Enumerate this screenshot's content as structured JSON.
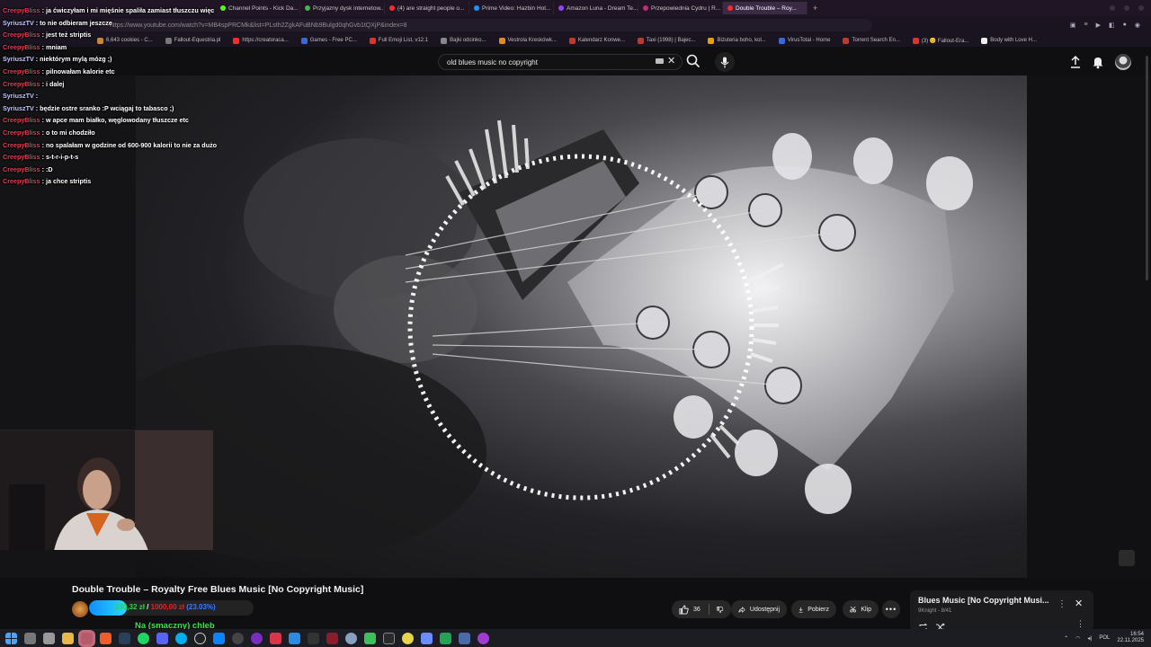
{
  "browser": {
    "tabs": [
      {
        "label": "Channel Points - Kick Da...",
        "color": "#53fc18"
      },
      {
        "label": "Przyjazny dysk internetow...",
        "color": "#4caf50"
      },
      {
        "label": "(4) are straight people o...",
        "color": "#ff2a2a"
      },
      {
        "label": "Prime Video: Hazbin Hot...",
        "color": "#1a98ff"
      },
      {
        "label": "Amazon Luna - Dream Te...",
        "color": "#9146ff"
      },
      {
        "label": "Przepowiednia Cydru | R...",
        "color": "#c42a7a"
      },
      {
        "label": "Double Trouble – Roy...",
        "color": "#ff2a2a",
        "active": true
      }
    ],
    "new_tab_label": "+",
    "url": "https://www.youtube.com/watch?v=MB4spPRCMk&list=PLsth2ZgkAFuBNb9Bulgd0qhGvb1tQXjP&index=8",
    "bookmarks": [
      {
        "label": "6,643 cookies - C...",
        "color": "#c08a3a"
      },
      {
        "label": "Fallout-Equestria.pl",
        "color": "#777"
      },
      {
        "label": "https://creatoraca...",
        "color": "#ff2a2a"
      },
      {
        "label": "Games - Free PC...",
        "color": "#3a6ad8"
      },
      {
        "label": "Full Emoji List, v12.1",
        "color": "#e0322c"
      },
      {
        "label": "Bajki odcinko...",
        "color": "#888"
      },
      {
        "label": "Vestrola Kreskówk...",
        "color": "#e58a1f"
      },
      {
        "label": "Kalendarz Konwe...",
        "color": "#c0392b"
      },
      {
        "label": "Taxi (1998) | Bajec...",
        "color": "#c0392b"
      },
      {
        "label": "Biżuteria boho, kol...",
        "color": "#e6a100"
      },
      {
        "label": "VirusTotal - Home",
        "color": "#3a6ad8"
      },
      {
        "label": "Torrent Search En...",
        "color": "#c0392b"
      },
      {
        "label": "(3) 😊 Fallout-Era...",
        "color": "#e0322c"
      },
      {
        "label": "Body with Love H...",
        "color": "#eee"
      }
    ]
  },
  "youtube": {
    "search_query": "old blues music no copyright",
    "video_title": "Double Trouble – Royalty Free Blues Music [No Copyright Music]",
    "actions": {
      "likes": "36",
      "share": "Udostępnij",
      "download": "Pobierz",
      "clip": "Klip"
    },
    "mini_player": {
      "title": "Blues Music [No Copyright Musi...",
      "subtitle": "9Knight - 8/41"
    }
  },
  "stream_overlay": {
    "goal": {
      "current": "230,32 zł",
      "separator": "/",
      "target": "1000,00 zł",
      "percent": "(23.03%)",
      "fraction": 0.2303
    },
    "caption": "Na (smaczny) chleb",
    "chat": [
      {
        "user": "CreepyBliss",
        "text": ": ja ćwiczyłam i mi mięśnie spaliła zamiast tłuszczu więc",
        "color": "red"
      },
      {
        "user": "SyriuszTV",
        "text": ": to nie odbieram jeszcze",
        "color": "blue"
      },
      {
        "user": "CreepyBliss",
        "text": ": jest też striptis",
        "color": "red"
      },
      {
        "user": "CreepyBliss",
        "text": ": mniam",
        "color": "red"
      },
      {
        "user": "SyriuszTV",
        "text": ": niektórym mylą mózg ;)",
        "color": "blue"
      },
      {
        "user": "CreepyBliss",
        "text": ": pilnowałam kalorie etc",
        "color": "red"
      },
      {
        "user": "CreepyBliss",
        "text": ": i dalej",
        "color": "red"
      },
      {
        "user": "SyriuszTV",
        "text": ":",
        "color": "blue"
      },
      {
        "user": "SyriuszTV",
        "text": ": będzie ostre sranko :P wciągaj to tabasco ;)",
        "color": "blue"
      },
      {
        "user": "CreepyBliss",
        "text": ": w apce mam białko, węglowodany tłuszcze etc",
        "color": "red"
      },
      {
        "user": "CreepyBliss",
        "text": ": o to mi chodziło",
        "color": "red"
      },
      {
        "user": "CreepyBliss",
        "text": ": no spalałam w godzine od 600-900 kalorii to nie za dużo",
        "color": "red"
      },
      {
        "user": "CreepyBliss",
        "text": ": s-t-r-i-p-t-s",
        "color": "red"
      },
      {
        "user": "CreepyBliss",
        "text": ": :D",
        "color": "red"
      },
      {
        "user": "CreepyBliss",
        "text": ": ja chce striptis",
        "color": "red"
      }
    ]
  },
  "taskbar": {
    "language": "POL",
    "time": "16:54",
    "date": "22.11.2025"
  }
}
